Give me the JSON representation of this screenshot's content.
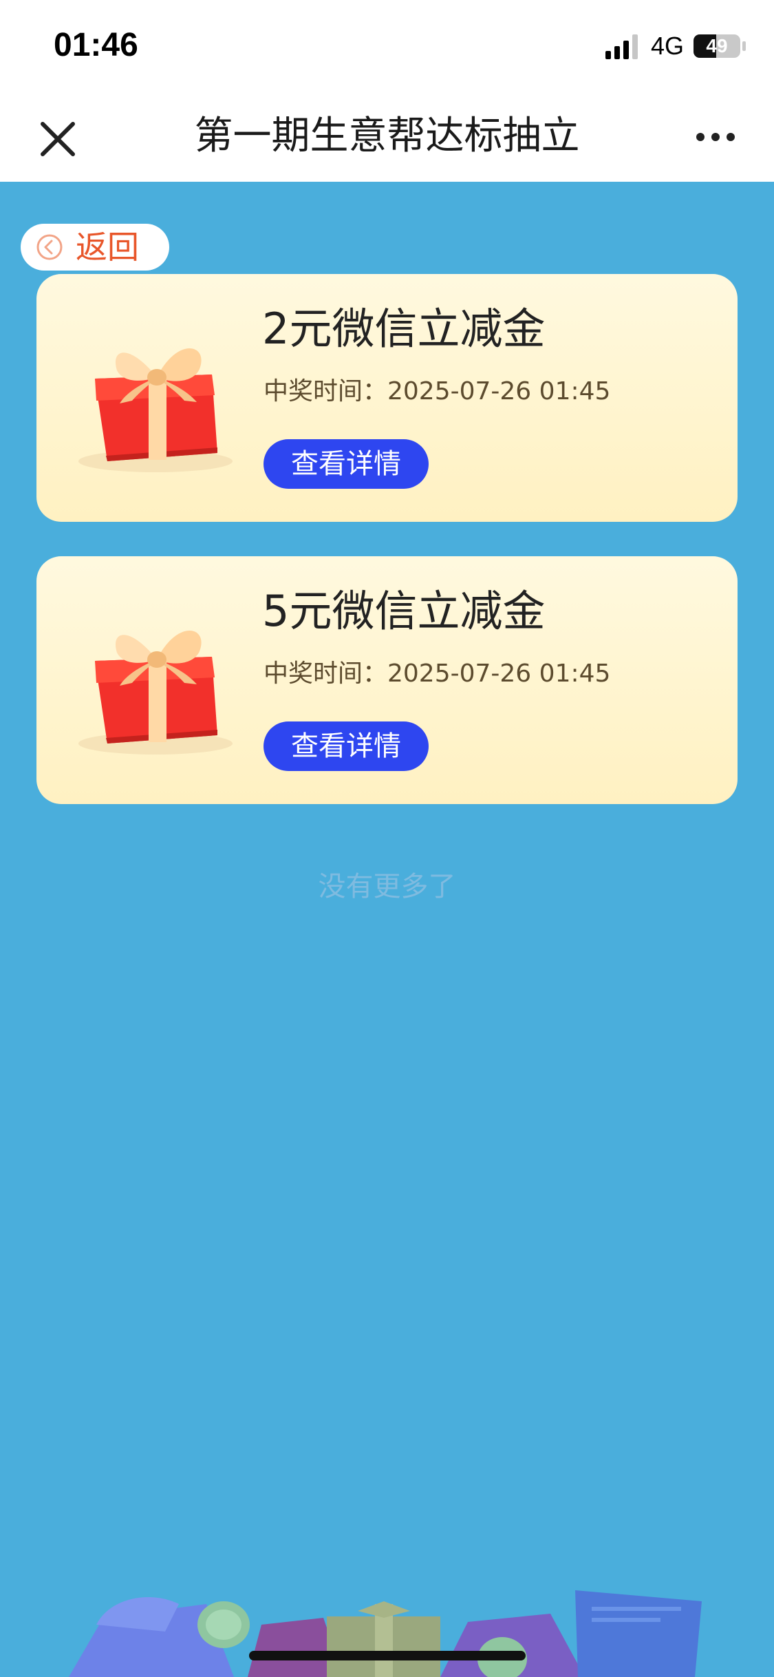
{
  "status_bar": {
    "time": "01:46",
    "network": "4G",
    "battery": "49",
    "battery_level": 0.49
  },
  "nav": {
    "title": "第一期生意帮达标抽立",
    "close_icon": "close-icon",
    "more_icon": "more-dots-icon"
  },
  "back_button": {
    "label": "返回",
    "icon": "chevron-left-circle-icon",
    "color": "#e8562a"
  },
  "prizes": [
    {
      "name": "2元微信立减金",
      "time_label": "中奖时间：2025-07-26 01:45",
      "button_label": "查看详情",
      "icon": "gift-box-icon"
    },
    {
      "name": "5元微信立减金",
      "time_label": "中奖时间：2025-07-26 01:45",
      "button_label": "查看详情",
      "icon": "gift-box-icon"
    }
  ],
  "footer": {
    "no_more_text": "没有更多了"
  },
  "colors": {
    "background": "#4aaedc",
    "card": "#fff5d2",
    "button": "#2e46f0",
    "gift_red": "#f2302b",
    "gift_ribbon": "#ffd9a6"
  }
}
